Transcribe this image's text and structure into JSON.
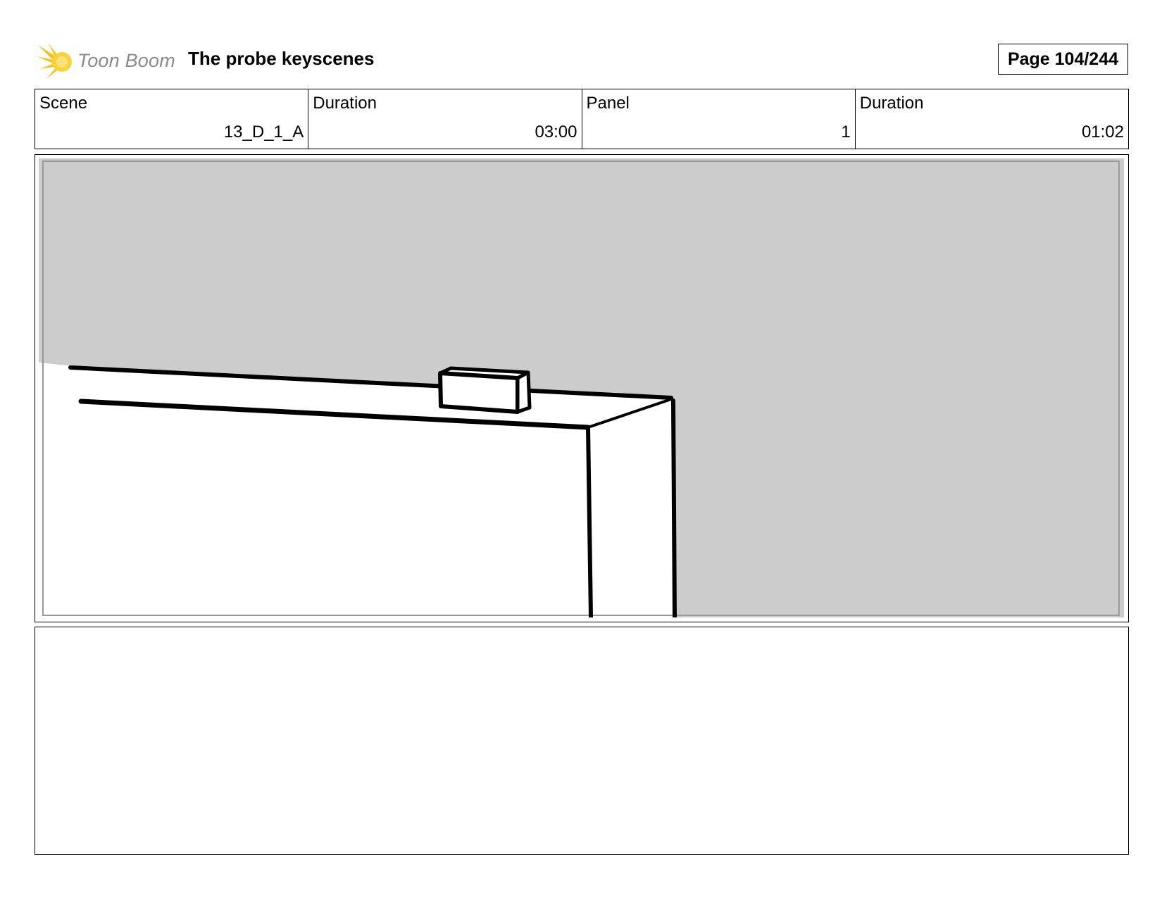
{
  "header": {
    "logo_text": "Toon Boom",
    "title": "The probe keyscenes",
    "page_label": "Page 104/244"
  },
  "info": [
    {
      "label": "Scene",
      "value": "13_D_1_A"
    },
    {
      "label": "Duration",
      "value": "03:00"
    },
    {
      "label": "Panel",
      "value": "1"
    },
    {
      "label": "Duration",
      "value": "01:02"
    }
  ],
  "panel": {
    "background_color": "#cccccc",
    "foreground_color": "#ffffff",
    "line_color": "#000000"
  },
  "notes": {
    "text": ""
  }
}
